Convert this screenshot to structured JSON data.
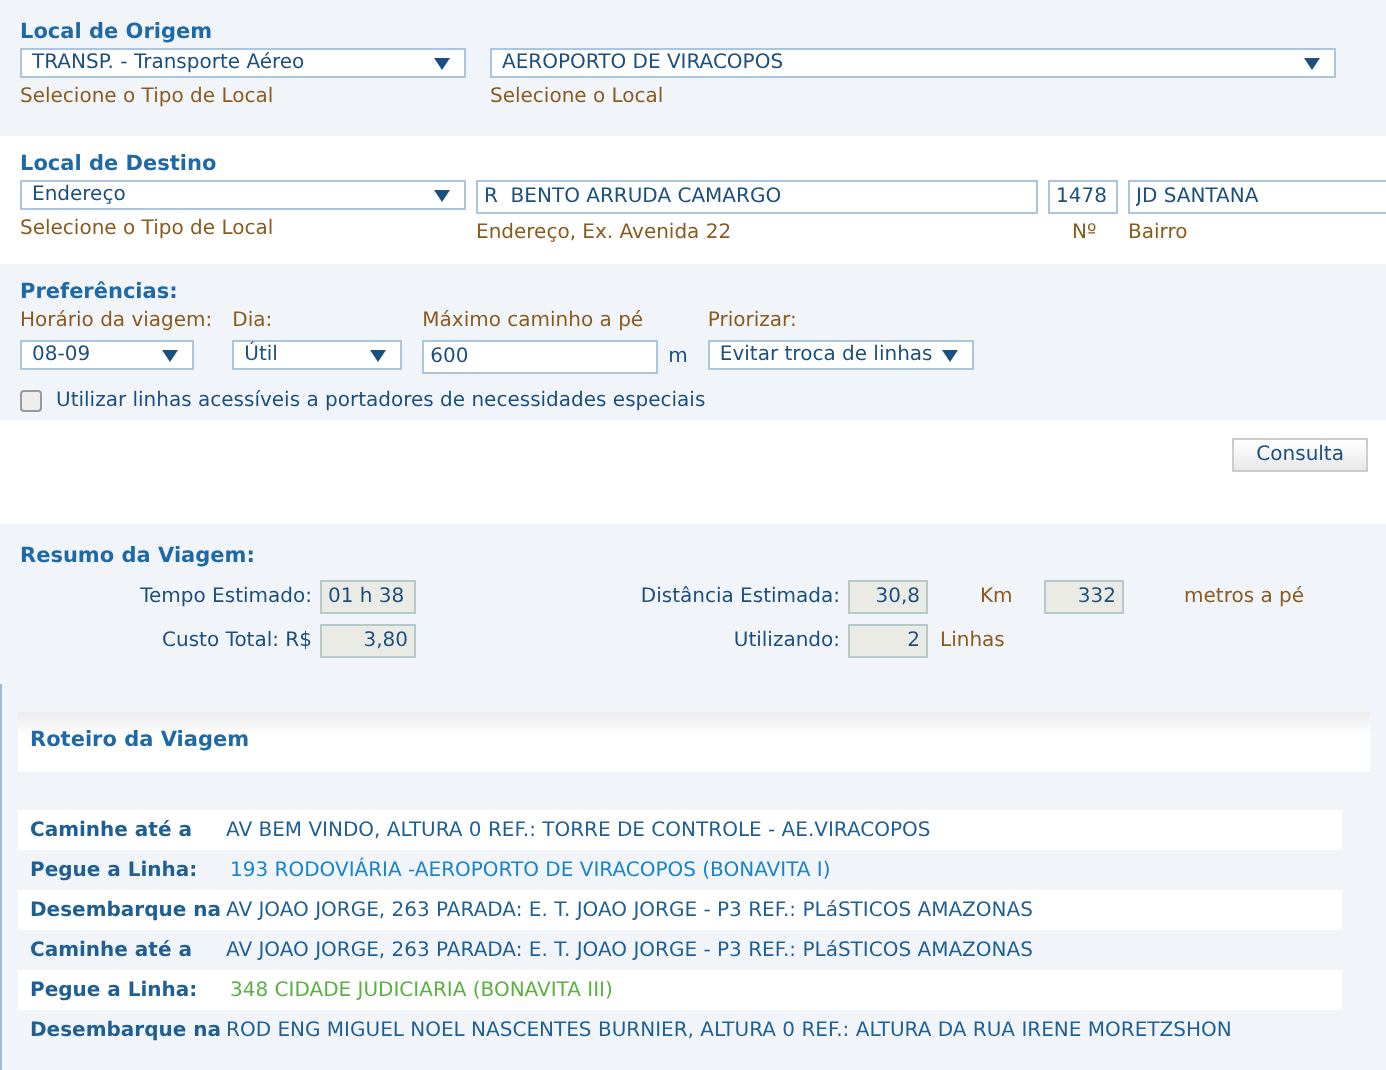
{
  "origin": {
    "title": "Local de Origem",
    "type_select": {
      "value": "TRANSP. - Transporte Aéreo",
      "hint": "Selecione o Tipo de Local"
    },
    "place_select": {
      "value": "AEROPORTO DE VIRACOPOS",
      "hint": "Selecione o Local"
    }
  },
  "destination": {
    "title": "Local de Destino",
    "type_select": {
      "value": "Endereço",
      "hint": "Selecione o Tipo de Local"
    },
    "street": {
      "value": "R  BENTO ARRUDA CAMARGO",
      "hint": "Endereço, Ex. Avenida 22"
    },
    "number": {
      "value": "1478",
      "hint": "Nº"
    },
    "district": {
      "value": "JD SANTANA",
      "hint": "Bairro"
    }
  },
  "preferences": {
    "title": "Preferências:",
    "time": {
      "label": "Horário da viagem:",
      "value": "08-09"
    },
    "day": {
      "label": "Dia:",
      "value": "Útil"
    },
    "walk": {
      "label": "Máximo caminho a pé",
      "value": "600",
      "unit": "m"
    },
    "priority": {
      "label": "Priorizar:",
      "value": "Evitar troca de linhas"
    },
    "accessible": {
      "label": "Utilizar linhas acessíveis a portadores de necessidades especiais",
      "checked": false
    }
  },
  "submit_button": "Consulta",
  "summary": {
    "title": "Resumo da Viagem:",
    "time": {
      "label": "Tempo Estimado:",
      "value": "01 h 38"
    },
    "distance": {
      "label": "Distância Estimada:",
      "value": "30,8",
      "unit": "Km"
    },
    "walk": {
      "value": "332",
      "unit": "metros a pé"
    },
    "cost": {
      "label": "Custo Total: R$",
      "value": "3,80"
    },
    "lines": {
      "label": "Utilizando:",
      "value": "2",
      "unit": "Linhas"
    }
  },
  "route": {
    "title": "Roteiro da Viagem",
    "steps": [
      {
        "kind": "walk",
        "label": "Caminhe até a",
        "text": "AV BEM VINDO, ALTURA 0 REF.: TORRE DE CONTROLE - AE.VIRACOPOS"
      },
      {
        "kind": "line",
        "label": "Pegue a Linha:",
        "text": "193 RODOVIÁRIA -AEROPORTO DE VIRACOPOS (BONAVITA I)",
        "color": "#1a84c8"
      },
      {
        "kind": "alight",
        "label": "Desembarque na",
        "text": "AV JOAO JORGE, 263 PARADA: E. T. JOAO JORGE - P3 REF.: PLáSTICOS AMAZONAS"
      },
      {
        "kind": "walk",
        "label": "Caminhe até a",
        "text": "AV JOAO JORGE, 263 PARADA: E. T. JOAO JORGE - P3 REF.: PLáSTICOS AMAZONAS"
      },
      {
        "kind": "line",
        "label": "Pegue a Linha:",
        "text": "348 CIDADE JUDICIARIA (BONAVITA III)",
        "color": "#5bb043"
      },
      {
        "kind": "alight",
        "label": "Desembarque na",
        "text": "ROD ENG MIGUEL NOEL NASCENTES BURNIER, ALTURA 0 REF.: ALTURA DA RUA IRENE MORETZSHON"
      }
    ]
  }
}
